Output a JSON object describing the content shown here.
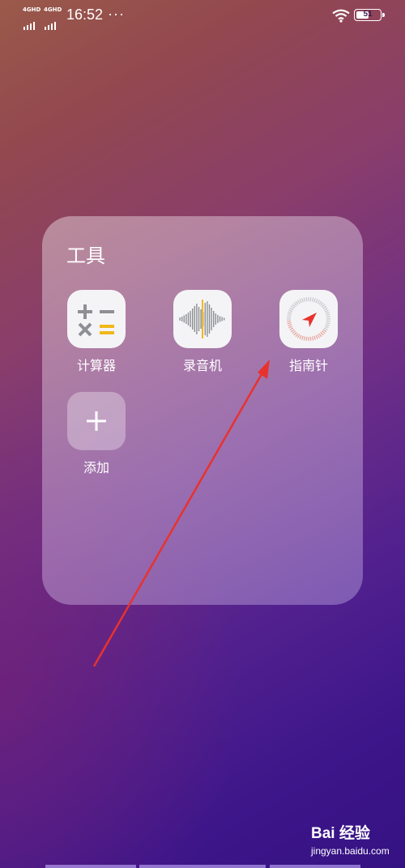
{
  "status_bar": {
    "signal1_label": "4GHD",
    "signal2_label": "4GHD",
    "time": "16:52",
    "more": "···",
    "battery": "51",
    "battery_level": 0.51
  },
  "folder": {
    "title": "工具",
    "apps": [
      {
        "label": "计算器",
        "icon": "calculator-icon"
      },
      {
        "label": "录音机",
        "icon": "recorder-icon"
      },
      {
        "label": "指南针",
        "icon": "compass-icon"
      },
      {
        "label": "添加",
        "icon": "plus-icon"
      }
    ]
  },
  "annotation": {
    "type": "arrow",
    "color": "#e8322e",
    "points_to": "指南针"
  },
  "watermark": {
    "logo": "Bai 经验",
    "site": "jingyan.baidu.com"
  }
}
